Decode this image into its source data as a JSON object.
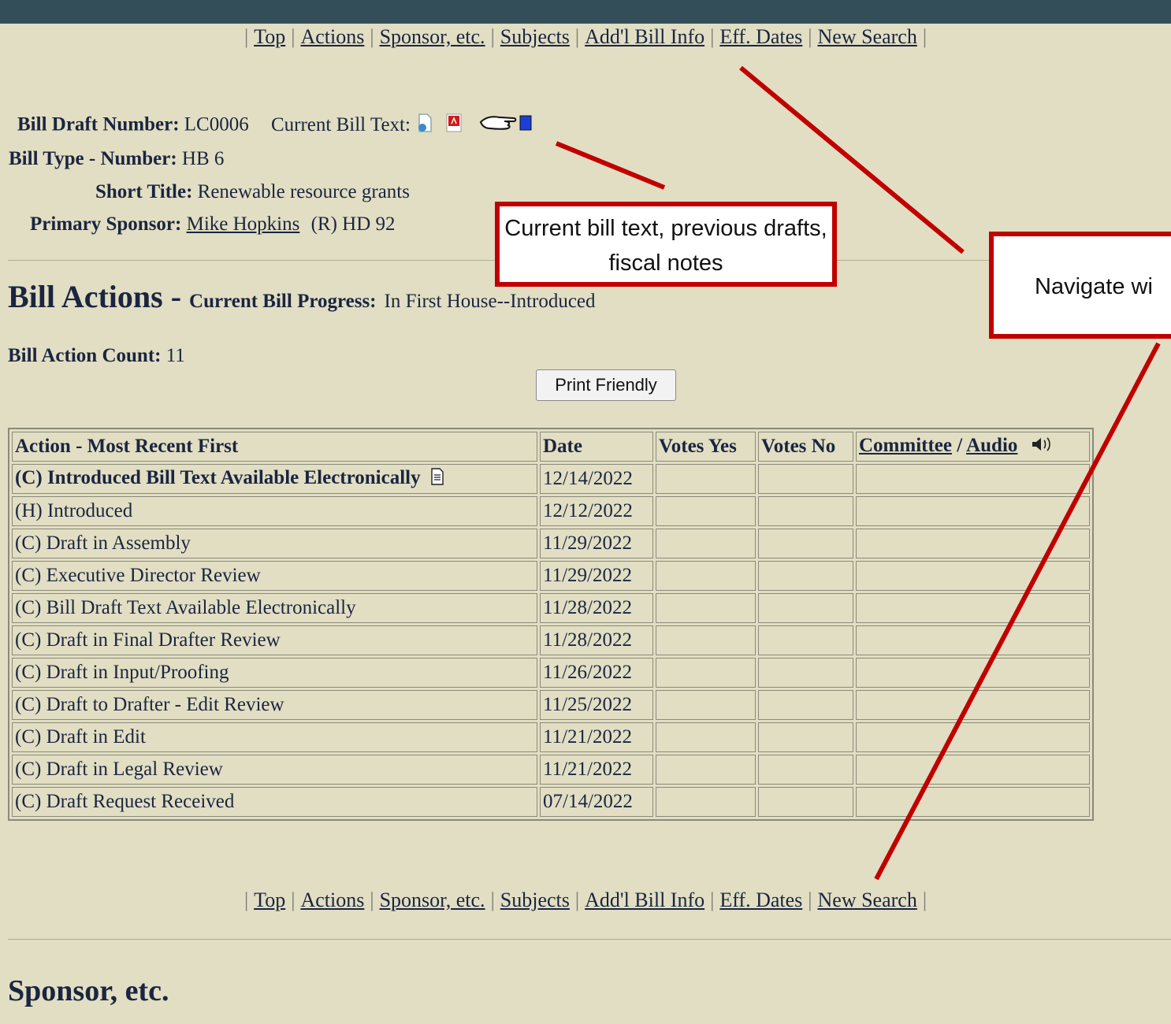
{
  "nav": {
    "links": [
      "Top",
      "Actions",
      "Sponsor, etc.",
      "Subjects",
      "Add'l Bill Info",
      "Eff. Dates",
      "New Search"
    ],
    "separator": "|"
  },
  "bill": {
    "draft_number_label": "Bill Draft Number:",
    "draft_number": "LC0006",
    "current_text_label": "Current Bill Text:",
    "type_label": "Bill Type - Number:",
    "type_value": "HB 6",
    "short_title_label": "Short Title:",
    "short_title": "Renewable resource grants",
    "sponsor_label": "Primary Sponsor:",
    "sponsor_name": "Mike Hopkins",
    "sponsor_party": "(R) HD 92"
  },
  "actions_section": {
    "title": "Bill Actions -",
    "progress_label": "Current Bill Progress:",
    "progress_value": "In First House--Introduced",
    "count_label": "Bill Action Count:",
    "count_value": "11",
    "print_button": "Print Friendly"
  },
  "table": {
    "headers": {
      "action": "Action - Most Recent First",
      "date": "Date",
      "votes_yes": "Votes Yes",
      "votes_no": "Votes No",
      "committee": "Committee",
      "slash": "/",
      "audio": "Audio"
    },
    "rows": [
      {
        "action": "(C) Introduced Bill Text Available Electronically",
        "date": "12/14/2022"
      },
      {
        "action": "(H) Introduced",
        "date": "12/12/2022"
      },
      {
        "action": "(C) Draft in Assembly",
        "date": "11/29/2022"
      },
      {
        "action": "(C) Executive Director Review",
        "date": "11/29/2022"
      },
      {
        "action": "(C) Bill Draft Text Available Electronically",
        "date": "11/28/2022"
      },
      {
        "action": "(C) Draft in Final Drafter Review",
        "date": "11/28/2022"
      },
      {
        "action": "(C) Draft in Input/Proofing",
        "date": "11/26/2022"
      },
      {
        "action": "(C) Draft to Drafter - Edit Review",
        "date": "11/25/2022"
      },
      {
        "action": "(C) Draft in Edit",
        "date": "11/21/2022"
      },
      {
        "action": "(C) Draft in Legal Review",
        "date": "11/21/2022"
      },
      {
        "action": "(C) Draft Request Received",
        "date": "07/14/2022"
      }
    ]
  },
  "sponsor_section": {
    "title": "Sponsor, etc."
  },
  "annotations": {
    "bill_text_callout": "Current bill text, previous drafts, fiscal notes",
    "navigate_callout": "Navigate wi",
    "accent_color": "#c00000"
  }
}
